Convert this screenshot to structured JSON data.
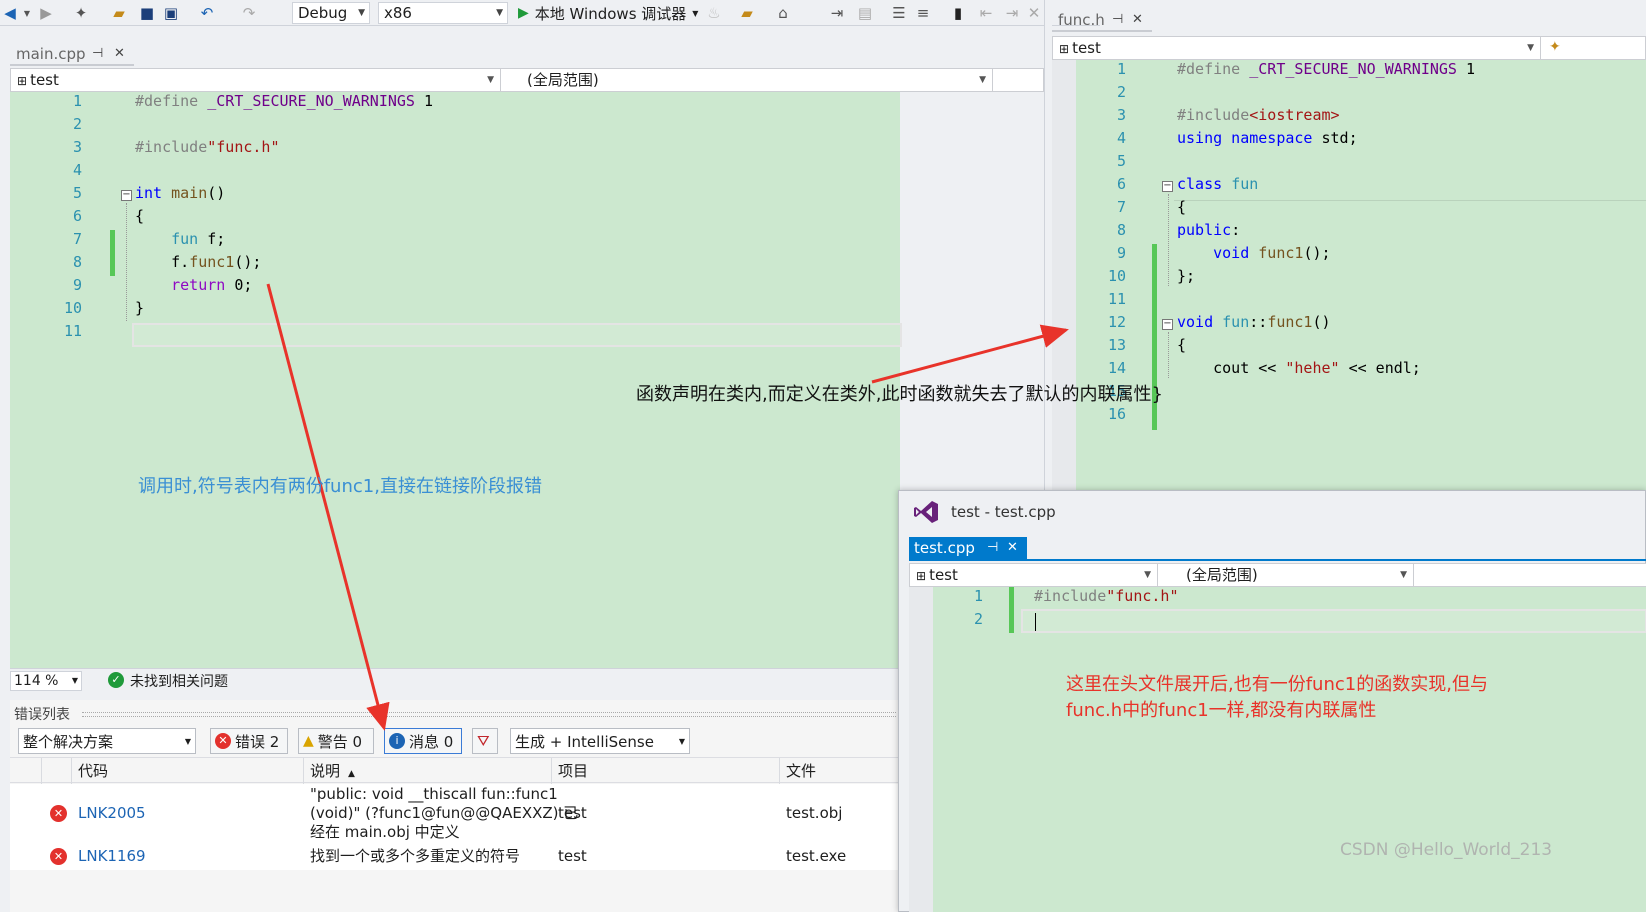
{
  "toolbar": {
    "config": "Debug",
    "platform": "x86",
    "run_label": "本地 Windows 调试器"
  },
  "left_editor": {
    "tab_label": "main.cpp",
    "nav_project": "test",
    "nav_scope": "(全局范围)",
    "line_numbers": [
      "1",
      "2",
      "3",
      "4",
      "5",
      "6",
      "7",
      "8",
      "9",
      "10",
      "11"
    ],
    "zoom": "114 %",
    "health": "未找到相关问题"
  },
  "right_editor": {
    "tab_label": "func.h",
    "nav_project": "test",
    "line_numbers": [
      "1",
      "2",
      "3",
      "4",
      "5",
      "6",
      "7",
      "8",
      "9",
      "10",
      "11",
      "12",
      "13",
      "14",
      "15",
      "16"
    ]
  },
  "float_window": {
    "title": "test - test.cpp",
    "tab_label": "test.cpp",
    "nav_project": "test",
    "nav_scope": "(全局范围)",
    "line_numbers": [
      "1",
      "2"
    ]
  },
  "error_list": {
    "title": "错误列表",
    "scope": "整个解决方案",
    "errors_btn": "错误 2",
    "warnings_btn": "警告 0",
    "messages_btn": "消息 0",
    "build_filter": "生成 + IntelliSense",
    "headers": {
      "code": "代码",
      "desc": "说明",
      "project": "项目",
      "file": "文件"
    },
    "rows": [
      {
        "code": "LNK2005",
        "desc_line1": "\"public: void __thiscall fun::func1",
        "desc_line2": "(void)\" (?func1@fun@@QAEXXZ) 已",
        "desc_line3": "经在 main.obj 中定义",
        "project": "test",
        "file": "test.obj"
      },
      {
        "code": "LNK1169",
        "desc_line1": "找到一个或多个多重定义的符号",
        "project": "test",
        "file": "test.exe"
      }
    ]
  },
  "annotations": {
    "right_note": "函数声明在类内,而定义在类外,此时函数就失去了默认的内联属性}",
    "left_note": "调用时,符号表内有两份func1,直接在链接阶段报错",
    "bottom_note_line1": "这里在头文件展开后,也有一份func1的函数实现,但与",
    "bottom_note_line2": "func.h中的func1一样,都没有内联属性",
    "watermark": "CSDN @Hello_World_213"
  },
  "colors": {
    "editor_bg": "#cce8cf",
    "arrow": "#e8332a",
    "blue_note": "#3a8fd4",
    "red_note": "#e8332a",
    "vs_purple": "#68217a"
  }
}
